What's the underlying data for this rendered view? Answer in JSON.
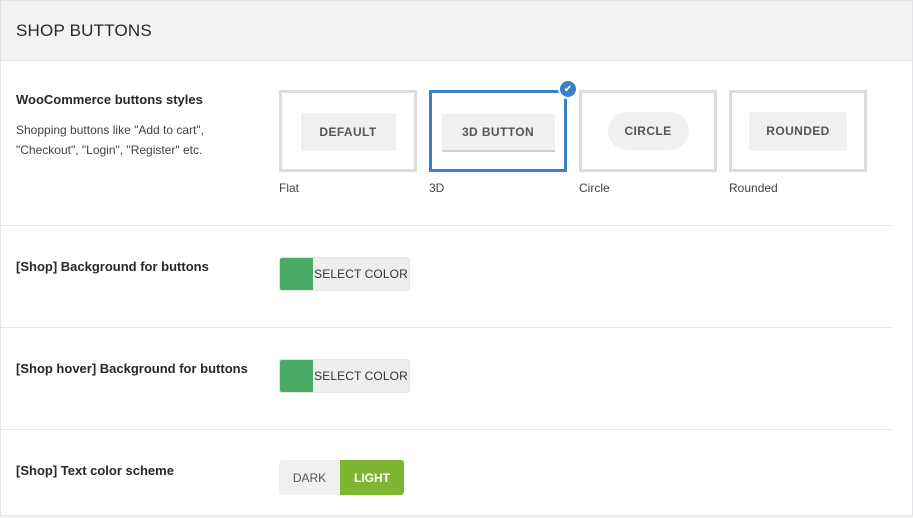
{
  "panel": {
    "title": "SHOP BUTTONS"
  },
  "button_styles": {
    "label": "WooCommerce buttons styles",
    "description": "Shopping buttons like \"Add to cart\", \"Checkout\", \"Login\", \"Register\" etc.",
    "selected": "3D",
    "options": [
      {
        "preview": "DEFAULT",
        "caption": "Flat"
      },
      {
        "preview": "3D BUTTON",
        "caption": "3D"
      },
      {
        "preview": "CIRCLE",
        "caption": "Circle"
      },
      {
        "preview": "ROUNDED",
        "caption": "Rounded"
      }
    ]
  },
  "shop_bg": {
    "label": "[Shop] Background for buttons",
    "button": "SELECT COLOR",
    "color": "#4aac64"
  },
  "shop_hover_bg": {
    "label": "[Shop hover] Background for buttons",
    "button": "SELECT COLOR",
    "color": "#4aac64"
  },
  "text_scheme": {
    "label": "[Shop] Text color scheme",
    "options": {
      "dark": "DARK",
      "light": "LIGHT"
    },
    "selected": "LIGHT",
    "active_color": "#7eb634"
  },
  "icons": {
    "selected_check": "check-icon"
  }
}
